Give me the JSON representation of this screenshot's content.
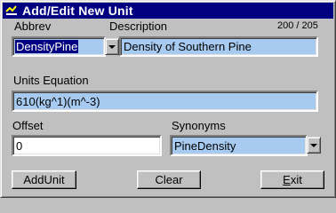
{
  "window": {
    "title": "Add/Edit New Unit",
    "record_counter": "200 / 205"
  },
  "labels": {
    "abbrev": "Abbrev",
    "description": "Description",
    "units_equation": "Units Equation",
    "offset": "Offset",
    "synonyms": "Synonyms"
  },
  "fields": {
    "abbrev_value": "DensityPine",
    "description_value": "Density of Southern Pine",
    "units_equation_value": "610(kg^1)(m^-3)",
    "offset_value": "0",
    "synonyms_value": "PineDensity"
  },
  "buttons": {
    "add_unit": "AddUnit",
    "clear": "Clear",
    "exit_first": "E",
    "exit_rest": "xit"
  },
  "colors": {
    "titlebar": "#000080",
    "field_blue": "#a6caf0",
    "selection": "#000080"
  }
}
